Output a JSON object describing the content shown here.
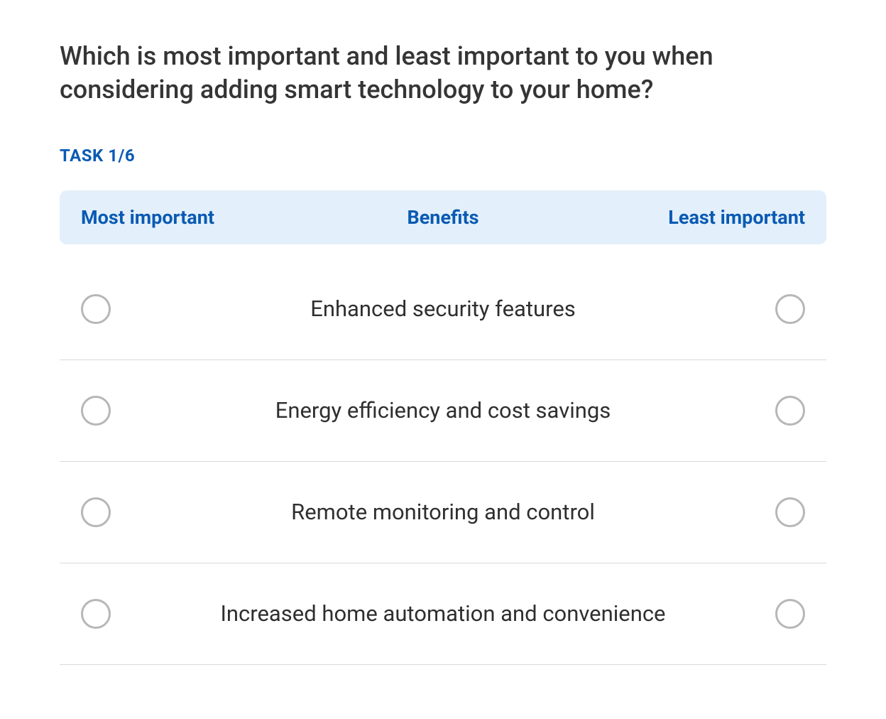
{
  "question": "Which is most important and least important to you when considering adding smart technology to your home?",
  "task_label": "TASK 1/6",
  "headers": {
    "left": "Most important",
    "center": "Benefits",
    "right": "Least important"
  },
  "options": [
    "Enhanced security features",
    "Energy efficiency and cost savings",
    "Remote monitoring and control",
    "Increased home automation and convenience"
  ]
}
